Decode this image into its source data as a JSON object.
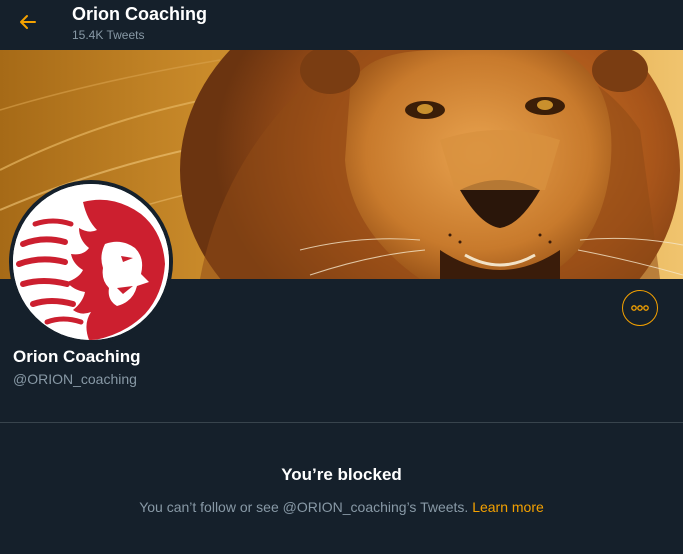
{
  "colors": {
    "background": "#15202b",
    "accent": "#f4a100",
    "muted_text": "#8899a6",
    "primary_text": "#ffffff",
    "divider": "#38444d",
    "logo_red": "#cc1f2f"
  },
  "header": {
    "back_icon": "arrow-left-icon",
    "title": "Orion Coaching",
    "subtitle": "15.4K Tweets"
  },
  "banner": {
    "description_icon": "lion-photo"
  },
  "profile": {
    "avatar_icon": "lion-head-logo",
    "more_icon": "more-horizontal-icon",
    "name": "Orion Coaching",
    "handle": "@ORION_coaching"
  },
  "blocked": {
    "title": "You’re blocked",
    "message": "You can’t follow or see @ORION_coaching’s Tweets.",
    "link_label": "Learn more"
  }
}
